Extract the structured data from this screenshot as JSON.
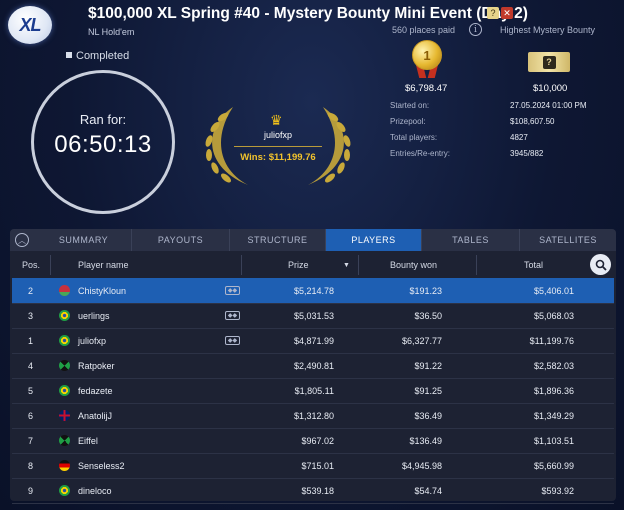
{
  "header": {
    "logo_text": "XL",
    "title": "$100,000 XL Spring #40 - Mystery Bounty Mini Event (Day 2)",
    "game_type": "NL Hold'em",
    "places_paid": "560 places paid",
    "highest_mystery_bounty_label": "Highest Mystery Bounty",
    "icons": [
      "mystery-bounty-icon",
      "close-icon",
      "info-icon"
    ]
  },
  "status": "Completed",
  "timer": {
    "label": "Ran for:",
    "value": "06:50:13"
  },
  "winner": {
    "name": "juliofxp",
    "wins": "Wins: $11,199.76"
  },
  "prizes": {
    "first_place_badge": "1",
    "first_place_amount": "$6,798.47",
    "mystery_ticket_symbol": "?",
    "highest_bounty_amount": "$10,000"
  },
  "details": [
    {
      "label": "Started on:",
      "value": "27.05.2024   01:00 PM"
    },
    {
      "label": "Prizepool:",
      "value": "$108,607.50"
    },
    {
      "label": "Total players:",
      "value": "4827"
    },
    {
      "label": "Entries/Re-entry:",
      "value": "3945/882"
    }
  ],
  "tabs": [
    {
      "label": "SUMMARY",
      "active": false
    },
    {
      "label": "PAYOUTS",
      "active": false
    },
    {
      "label": "STRUCTURE",
      "active": false
    },
    {
      "label": "PLAYERS",
      "active": true
    },
    {
      "label": "TABLES",
      "active": false
    },
    {
      "label": "SATELLITES",
      "active": false
    }
  ],
  "table": {
    "columns": {
      "pos": "Pos.",
      "player": "Player name",
      "prize": "Prize",
      "bounty": "Bounty won",
      "total": "Total"
    },
    "sort_column": "prize",
    "rows": [
      {
        "pos": "2",
        "flag": "belarus",
        "name": "ChistyKloun",
        "bounty_icon": true,
        "prize": "$5,214.78",
        "bounty": "$191.23",
        "total": "$5,406.01",
        "selected": true
      },
      {
        "pos": "3",
        "flag": "brazil",
        "name": "uerlings",
        "bounty_icon": true,
        "prize": "$5,031.53",
        "bounty": "$36.50",
        "total": "$5,068.03",
        "selected": false
      },
      {
        "pos": "1",
        "flag": "brazil",
        "name": "juliofxp",
        "bounty_icon": true,
        "prize": "$4,871.99",
        "bounty": "$6,327.77",
        "total": "$11,199.76",
        "selected": false
      },
      {
        "pos": "4",
        "flag": "jamaica",
        "name": "Ratpoker",
        "bounty_icon": false,
        "prize": "$2,490.81",
        "bounty": "$91.22",
        "total": "$2,582.03",
        "selected": false
      },
      {
        "pos": "5",
        "flag": "brazil",
        "name": "fedazete",
        "bounty_icon": false,
        "prize": "$1,805.11",
        "bounty": "$91.25",
        "total": "$1,896.36",
        "selected": false
      },
      {
        "pos": "6",
        "flag": "uk",
        "name": "AnatolijJ",
        "bounty_icon": false,
        "prize": "$1,312.80",
        "bounty": "$36.49",
        "total": "$1,349.29",
        "selected": false
      },
      {
        "pos": "7",
        "flag": "jamaica",
        "name": "Eiffel",
        "bounty_icon": false,
        "prize": "$967.02",
        "bounty": "$136.49",
        "total": "$1,103.51",
        "selected": false
      },
      {
        "pos": "8",
        "flag": "germany",
        "name": "Senseless2",
        "bounty_icon": false,
        "prize": "$715.01",
        "bounty": "$4,945.98",
        "total": "$5,660.99",
        "selected": false
      },
      {
        "pos": "9",
        "flag": "brazil",
        "name": "dineloco",
        "bounty_icon": false,
        "prize": "$539.18",
        "bounty": "$54.74",
        "total": "$593.92",
        "selected": false
      }
    ]
  },
  "colors": {
    "accent": "#1e5fb3",
    "gold": "#f2c32c",
    "background": "#0e1733",
    "panel": "#1d2233"
  }
}
